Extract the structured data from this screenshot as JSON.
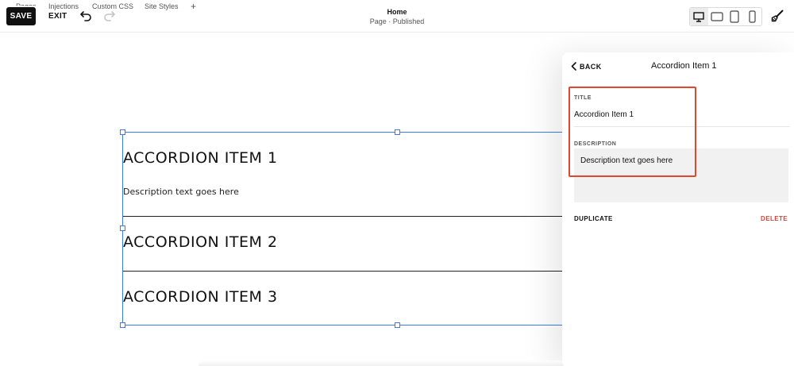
{
  "topbar": {
    "tabs": [
      "Pages",
      "Injections",
      "Custom CSS",
      "Site Styles",
      "+"
    ],
    "save_label": "SAVE",
    "exit_label": "EXIT",
    "page_title": "Home",
    "page_status": "Page · Published",
    "devices": [
      {
        "name": "desktop",
        "active": true
      },
      {
        "name": "tablet-landscape",
        "active": false
      },
      {
        "name": "tablet-portrait",
        "active": false
      },
      {
        "name": "mobile",
        "active": false
      }
    ]
  },
  "accordion": {
    "items": [
      {
        "title": "ACCORDION ITEM 1",
        "description": "Description text goes here",
        "expanded": true
      },
      {
        "title": "ACCORDION ITEM 2",
        "expanded": false
      },
      {
        "title": "ACCORDION ITEM 3",
        "expanded": false
      }
    ],
    "selection_color": "#3b7bf0"
  },
  "panel": {
    "back_label": "BACK",
    "title": "Accordion Item 1",
    "title_field_label": "TITLE",
    "title_field_value": "Accordion Item 1",
    "description_field_label": "DESCRIPTION",
    "description_field_value": "Description text goes here",
    "duplicate_label": "DUPLICATE",
    "delete_label": "DELETE",
    "delete_color": "#d0443a",
    "highlight_color": "#e0472f"
  }
}
